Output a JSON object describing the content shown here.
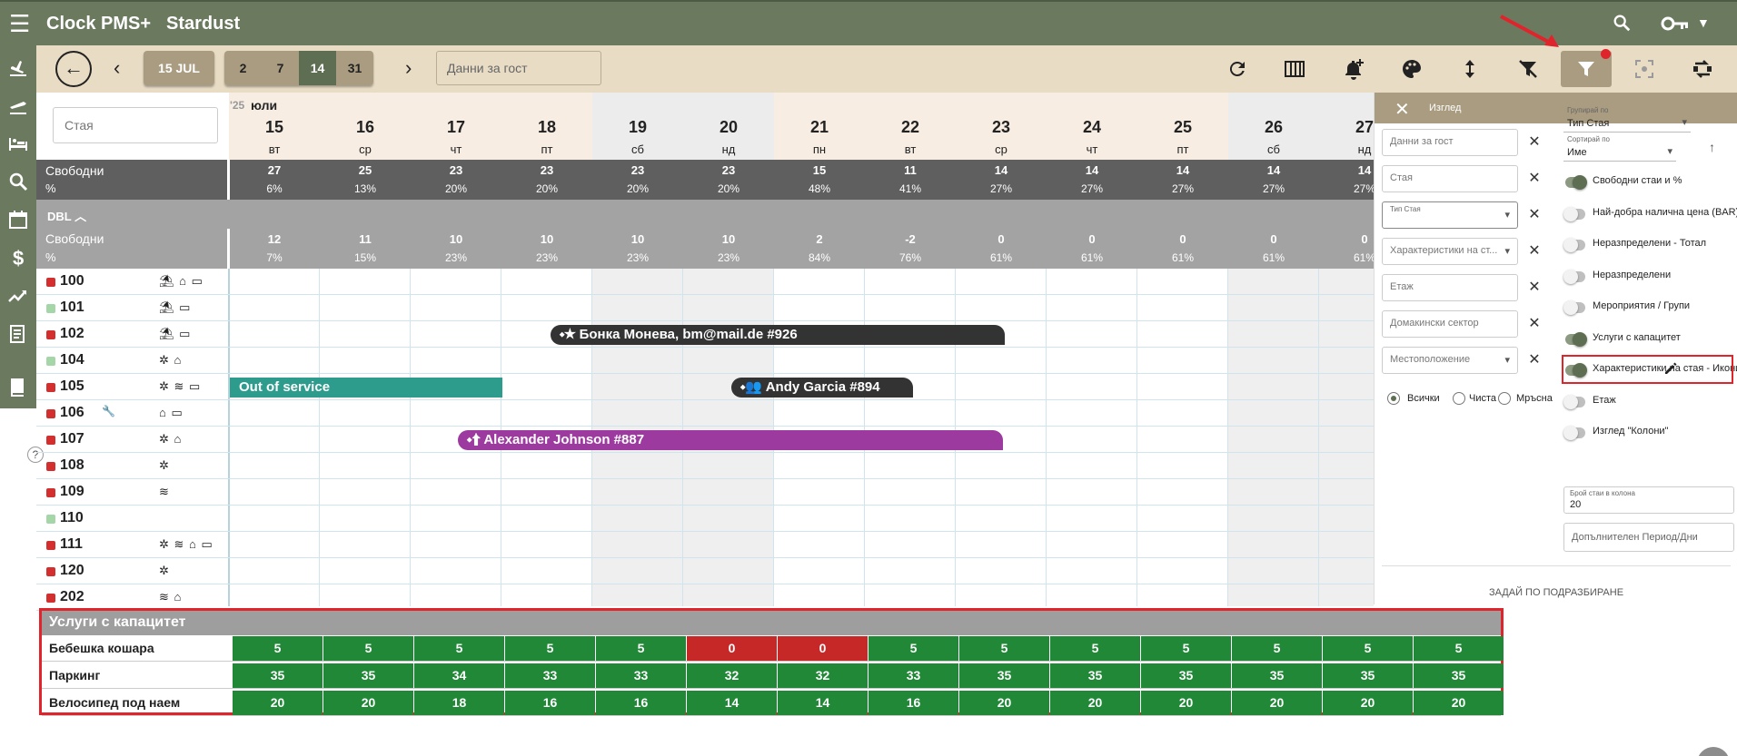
{
  "app": {
    "name": "Clock PMS+",
    "hotel": "Stardust"
  },
  "toolbar": {
    "date_button": "15 JUL",
    "ranges": [
      "2",
      "7",
      "14",
      "31"
    ],
    "active_range": "14",
    "guest_search_placeholder": "Данни за гост"
  },
  "grid": {
    "room_search_placeholder": "Стая",
    "year": "'25",
    "month": "юли",
    "days": [
      {
        "num": "15",
        "wd": "вт",
        "weekend": false
      },
      {
        "num": "16",
        "wd": "ср",
        "weekend": false
      },
      {
        "num": "17",
        "wd": "чт",
        "weekend": false
      },
      {
        "num": "18",
        "wd": "пт",
        "weekend": false
      },
      {
        "num": "19",
        "wd": "сб",
        "weekend": true
      },
      {
        "num": "20",
        "wd": "нд",
        "weekend": true
      },
      {
        "num": "21",
        "wd": "пн",
        "weekend": false
      },
      {
        "num": "22",
        "wd": "вт",
        "weekend": false
      },
      {
        "num": "23",
        "wd": "ср",
        "weekend": false
      },
      {
        "num": "24",
        "wd": "чт",
        "weekend": false
      },
      {
        "num": "25",
        "wd": "пт",
        "weekend": false
      },
      {
        "num": "26",
        "wd": "сб",
        "weekend": true
      },
      {
        "num": "27",
        "wd": "нд",
        "weekend": true
      }
    ],
    "availability": {
      "label": "Свободни",
      "pct_label": "%",
      "values": [
        "27",
        "25",
        "23",
        "23",
        "23",
        "23",
        "15",
        "11",
        "14",
        "14",
        "14",
        "14",
        "14"
      ],
      "pcts": [
        "6%",
        "13%",
        "20%",
        "20%",
        "20%",
        "20%",
        "48%",
        "41%",
        "27%",
        "27%",
        "27%",
        "27%",
        "27%"
      ]
    },
    "group": {
      "name": "DBL",
      "label": "Свободни",
      "pct_label": "%",
      "values": [
        "12",
        "11",
        "10",
        "10",
        "10",
        "10",
        "2",
        "-2",
        "0",
        "0",
        "0",
        "0",
        "0"
      ],
      "pcts": [
        "7%",
        "15%",
        "23%",
        "23%",
        "23%",
        "23%",
        "84%",
        "76%",
        "61%",
        "61%",
        "61%",
        "61%",
        "61%"
      ]
    },
    "rooms": [
      {
        "num": "100",
        "status": "#d32f2f",
        "icons": "⛱ ⌂ ▭"
      },
      {
        "num": "101",
        "status": "#a5d6a7",
        "icons": "⛱ ▭"
      },
      {
        "num": "102",
        "status": "#d32f2f",
        "icons": "⛱ ▭"
      },
      {
        "num": "104",
        "status": "#a5d6a7",
        "icons": "✲ ⌂"
      },
      {
        "num": "105",
        "status": "#d32f2f",
        "icons": "✲ ≋ ▭"
      },
      {
        "num": "106",
        "status": "#d32f2f",
        "icons": "⌂ ▭"
      },
      {
        "num": "107",
        "status": "#d32f2f",
        "icons": "✲ ⌂"
      },
      {
        "num": "108",
        "status": "#d32f2f",
        "icons": "✲"
      },
      {
        "num": "109",
        "status": "#d32f2f",
        "icons": "≋"
      },
      {
        "num": "110",
        "status": "#a5d6a7",
        "icons": ""
      },
      {
        "num": "111",
        "status": "#d32f2f",
        "icons": "✲ ≋ ⌂ ▭"
      },
      {
        "num": "120",
        "status": "#d32f2f",
        "icons": "✲"
      },
      {
        "num": "202",
        "status": "#d32f2f",
        "icons": "≋ ⌂"
      }
    ],
    "bookings": [
      {
        "label": "Бонка Монева, bm@mail.de #926",
        "color": "#333333"
      },
      {
        "label": "Out of service",
        "color": "#2e9c8d"
      },
      {
        "label": "Andy Garcia #894",
        "color": "#333333"
      },
      {
        "label": "Alexander Johnson #887",
        "color": "#9c3aa0"
      }
    ]
  },
  "services": {
    "title": "Услуги с капацитет",
    "rows": [
      {
        "name": "Бебешка кошара",
        "values": [
          "5",
          "5",
          "5",
          "5",
          "5",
          "0",
          "0",
          "5",
          "5",
          "5",
          "5",
          "5",
          "5",
          "5"
        ]
      },
      {
        "name": "Паркинг",
        "values": [
          "35",
          "35",
          "34",
          "33",
          "33",
          "32",
          "32",
          "33",
          "35",
          "35",
          "35",
          "35",
          "35",
          "35"
        ]
      },
      {
        "name": "Велосипед под наем",
        "values": [
          "20",
          "20",
          "18",
          "16",
          "16",
          "14",
          "14",
          "16",
          "20",
          "20",
          "20",
          "20",
          "20",
          "20"
        ]
      }
    ],
    "ok_color": "#218838",
    "zero_color": "#c62828"
  },
  "panel": {
    "title": "Изглед",
    "fields": [
      {
        "label": "Данни за гост",
        "select": false
      },
      {
        "label": "Стая",
        "select": false
      },
      {
        "label": "Тип Стая",
        "select": true,
        "floating": true
      },
      {
        "label": "Характеристики на ст...",
        "select": true
      },
      {
        "label": "Етаж",
        "select": false
      },
      {
        "label": "Домакински сектор",
        "select": false
      },
      {
        "label": "Местоположение",
        "select": true
      }
    ],
    "radios": [
      "Всички",
      "Чиста",
      "Мръсна"
    ],
    "group_by": {
      "label": "Групирай по",
      "value": "Тип Стая"
    },
    "sort_by": {
      "label": "Сортирай по",
      "value": "Име"
    },
    "toggles": [
      {
        "label": "Свободни стаи и %",
        "on": true
      },
      {
        "label": "Най-добра налична цена (BAR)",
        "on": false
      },
      {
        "label": "Неразпределени - Тотал",
        "on": false
      },
      {
        "label": "Неразпределени",
        "on": false
      },
      {
        "label": "Мероприятия / Групи",
        "on": false
      },
      {
        "label": "Услуги с капацитет",
        "on": true
      },
      {
        "label": "Характеристики на стая - Икони",
        "on": true
      },
      {
        "label": "Етаж",
        "on": false
      },
      {
        "label": "Изглед \"Колони\"",
        "on": false
      }
    ],
    "rooms_per_column": {
      "label": "Брой стаи в колона",
      "value": "20"
    },
    "extra_period_placeholder": "Допълнителен Период/Дни",
    "reset_label": "ЗАДАЙ ПО ПОДРАЗБИРАНЕ"
  }
}
